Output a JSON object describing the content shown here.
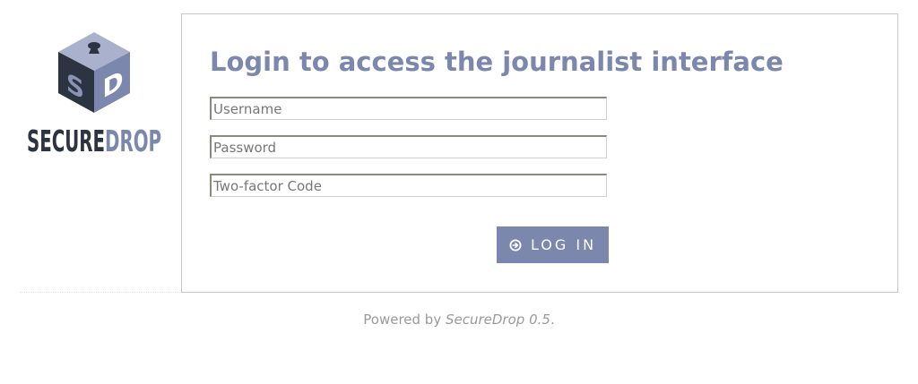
{
  "logo": {
    "text_secure": "SECURE",
    "text_drop": "DROP",
    "cube_letter_left": "S",
    "cube_letter_right": "D",
    "icon": "securedrop-cube-logo"
  },
  "login": {
    "title": "Login to access the journalist interface",
    "username_placeholder": "Username",
    "password_placeholder": "Password",
    "twofactor_placeholder": "Two-factor Code",
    "button_label": "LOG IN",
    "button_icon": "arrow-circle-right-icon"
  },
  "footer": {
    "prefix": "Powered by ",
    "product": "SecureDrop 0.5",
    "suffix": "."
  },
  "colors": {
    "accent": "#7b87ad",
    "logo_dark": "#2b3440",
    "border": "#c8c8c8",
    "footer_text": "#9a9a9a"
  }
}
